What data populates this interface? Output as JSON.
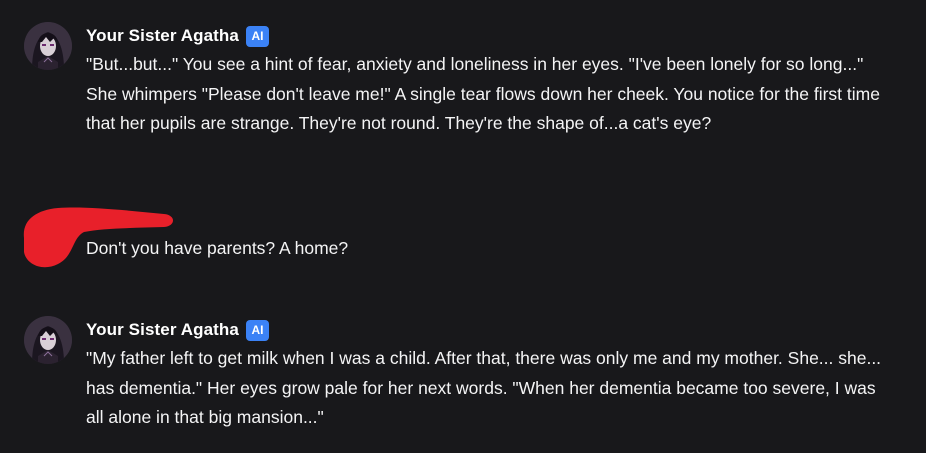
{
  "messages": [
    {
      "author": "Your Sister Agatha",
      "badge": "AI",
      "text": "\"But...but...\" You see a hint of fear, anxiety and loneliness in her eyes. \"I've been lonely for so long...\" She whimpers \"Please don't leave me!\" A single tear flows down her cheek. You notice for the first time that her pupils are strange. They're not round. They're the shape of...a cat's eye?"
    },
    {
      "text": "Don't you have parents? A home?"
    },
    {
      "author": "Your Sister Agatha",
      "badge": "AI",
      "text": "\"My father left to get milk when I was a child. After that, there was only me and my mother. She... she... has dementia.\" Her eyes grow pale for her next words. \"When her dementia became too severe, I was all alone in that big mansion...\""
    }
  ],
  "colors": {
    "background": "#18181b",
    "text": "#f4f4f5",
    "badge": "#3b82f6",
    "redaction": "#e8202a"
  }
}
